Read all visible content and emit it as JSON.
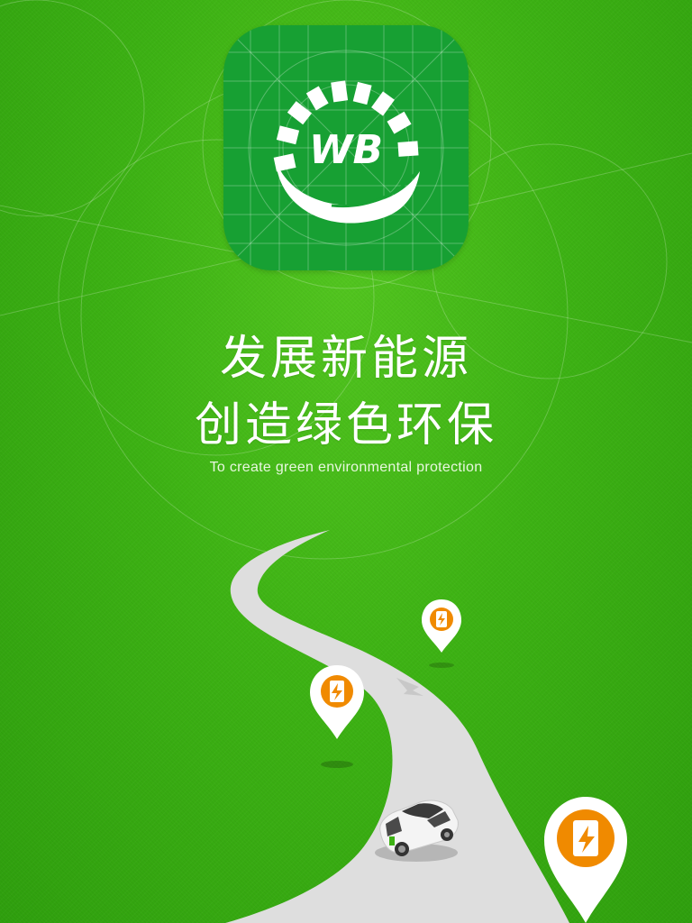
{
  "app_icon": {
    "name": "wb-logo-icon",
    "text": "WB",
    "color": "#17a033"
  },
  "headline": {
    "line1": "发展新能源",
    "line2": "创造绿色环保",
    "subtitle": "To create green environmental protection"
  },
  "colors": {
    "background": "#3db214",
    "road": "#dcdcdc",
    "pin_orange": "#f08a00",
    "pin_white": "#ffffff"
  },
  "illustration": {
    "pins": [
      "charging-station-pin-icon",
      "charging-station-pin-icon",
      "charging-station-pin-icon"
    ],
    "vehicle": "electric-car-icon",
    "road": "road-icon"
  }
}
